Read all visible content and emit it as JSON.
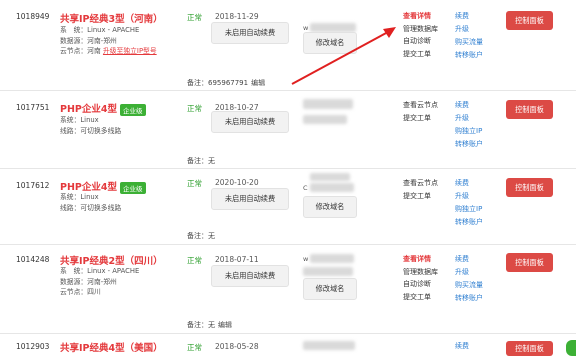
{
  "rows": [
    {
      "id": "1018949",
      "name": "共享IP经典3型（河南）",
      "info1": "系　统：Linux - APACHE",
      "info2": "数据源：河南-郑州",
      "info3_prefix": "云节点：河南",
      "info3_link": "升级至独立IP型号",
      "status": "正常",
      "date": "2018-11-29",
      "renew": "未启用自动续费",
      "domain_btn": "修改域名",
      "domain_prefix": "w",
      "ops": [
        "查看详情",
        "管理数据库",
        "自动诊断",
        "提交工单"
      ],
      "links": [
        "续费",
        "升级",
        "购买流量",
        "转移账户"
      ],
      "ctrl": "控制面板",
      "note_label": "备注：",
      "note_value": "695967791",
      "note_edit": "编辑"
    },
    {
      "id": "1017751",
      "name": "PHP企业4型",
      "badge": "企业级",
      "info1": "系统：Linux",
      "info2": "线路：可切换多线路",
      "status": "正常",
      "date": "2018-10-27",
      "renew": "未启用自动续费",
      "ops": [
        "查看云节点",
        "提交工单"
      ],
      "links": [
        "续费",
        "升级",
        "购独立IP",
        "转移账户"
      ],
      "ctrl": "控制面板",
      "note_label": "备注：",
      "note_value": "无"
    },
    {
      "id": "1017612",
      "name": "PHP企业4型",
      "badge": "企业级",
      "info1": "系统：Linux",
      "info2": "线路：可切换多线路",
      "status": "正常",
      "date": "2020-10-20",
      "renew": "未启用自动续费",
      "domain_btn": "修改域名",
      "domain_prefix": "C",
      "ops": [
        "查看云节点",
        "提交工单"
      ],
      "links": [
        "续费",
        "升级",
        "购独立IP",
        "转移账户"
      ],
      "ctrl": "控制面板",
      "note_label": "备注：",
      "note_value": "无"
    },
    {
      "id": "1014248",
      "name": "共享IP经典2型（四川）",
      "info1": "系　统：Linux - APACHE",
      "info2": "数据源：河南-郑州",
      "info3_prefix": "云节点：四川",
      "status": "正常",
      "date": "2018-07-11",
      "renew": "未启用自动续费",
      "domain_btn": "修改域名",
      "domain_prefix": "w",
      "ops": [
        "查看详情",
        "管理数据库",
        "自动诊断",
        "提交工单"
      ],
      "links": [
        "续费",
        "升级",
        "购买流量",
        "转移账户"
      ],
      "ctrl": "控制面板",
      "note_label": "备注：",
      "note_value": "无",
      "note_edit": "编辑"
    },
    {
      "id": "1012903",
      "name": "共享IP经典4型（美国）",
      "status": "正常",
      "date": "2018-05-28",
      "links": [
        "续费"
      ],
      "ctrl": "控制面板"
    }
  ],
  "annotation_color": "#e02020"
}
